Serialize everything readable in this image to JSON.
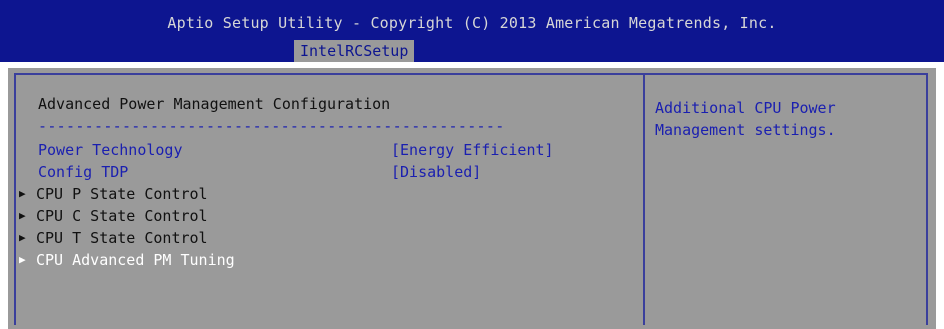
{
  "header": {
    "title": "Aptio Setup Utility - Copyright (C) 2013 American Megatrends, Inc.",
    "active_tab": "IntelRCSetup"
  },
  "main": {
    "section_title": "Advanced Power Management Configuration",
    "separator": "--------------------------------------------------",
    "settings": [
      {
        "label": "Power Technology",
        "value": "[Energy Efficient]"
      },
      {
        "label": "Config TDP",
        "value": "[Disabled]"
      }
    ],
    "submenus": [
      {
        "label": "CPU P State Control"
      },
      {
        "label": "CPU C State Control"
      },
      {
        "label": "CPU T State Control"
      },
      {
        "label": "CPU Advanced PM Tuning"
      }
    ],
    "selected_submenu": "CPU Advanced PM Tuning"
  },
  "help": {
    "text": "Additional CPU Power\nManagement settings."
  },
  "colors": {
    "header_bg": "#0d1590",
    "panel_bg": "#9a9a9a",
    "setting_text": "#1a1fb0",
    "selected_text": "#ffffff"
  }
}
